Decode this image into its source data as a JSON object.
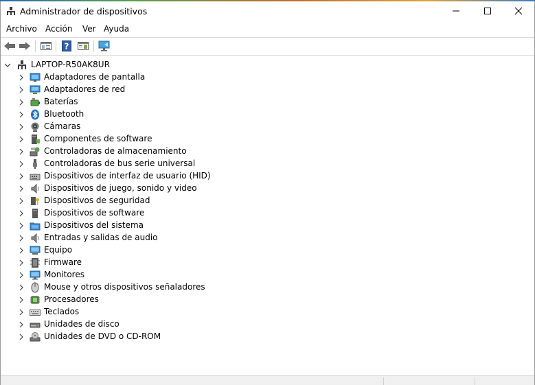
{
  "window": {
    "title": "Administrador de dispositivos",
    "icon": "device-manager-icon",
    "buttons": {
      "minimize": "minimize-icon",
      "maximize": "maximize-icon",
      "close": "close-icon"
    }
  },
  "menu": [
    "Archivo",
    "Acción",
    "Ver",
    "Ayuda"
  ],
  "toolbar": [
    "back-arrow-icon",
    "forward-arrow-icon",
    "properties-panel-icon",
    "help-icon",
    "console-tree-icon",
    "scan-hardware-monitor-icon"
  ],
  "tree": {
    "root": "LAPTOP-R50AK8UR",
    "items": [
      {
        "label": "Adaptadores de pantalla",
        "icon": "display-adapter-icon"
      },
      {
        "label": "Adaptadores de red",
        "icon": "network-adapter-icon"
      },
      {
        "label": "Baterías",
        "icon": "battery-icon"
      },
      {
        "label": "Bluetooth",
        "icon": "bluetooth-icon"
      },
      {
        "label": "Cámaras",
        "icon": "camera-icon"
      },
      {
        "label": "Componentes de software",
        "icon": "software-component-icon"
      },
      {
        "label": "Controladoras de almacenamiento",
        "icon": "storage-controller-icon"
      },
      {
        "label": "Controladoras de bus serie universal",
        "icon": "usb-icon"
      },
      {
        "label": "Dispositivos de interfaz de usuario (HID)",
        "icon": "hid-icon"
      },
      {
        "label": "Dispositivos de juego, sonido y video",
        "icon": "speaker-icon"
      },
      {
        "label": "Dispositivos de seguridad",
        "icon": "security-key-icon"
      },
      {
        "label": "Dispositivos de software",
        "icon": "software-device-icon"
      },
      {
        "label": "Dispositivos del sistema",
        "icon": "system-folder-icon"
      },
      {
        "label": "Entradas y salidas de audio",
        "icon": "audio-io-icon"
      },
      {
        "label": "Equipo",
        "icon": "computer-icon"
      },
      {
        "label": "Firmware",
        "icon": "firmware-icon"
      },
      {
        "label": "Monitores",
        "icon": "monitor-icon"
      },
      {
        "label": "Mouse y otros dispositivos señaladores",
        "icon": "mouse-icon"
      },
      {
        "label": "Procesadores",
        "icon": "processor-icon"
      },
      {
        "label": "Teclados",
        "icon": "keyboard-icon"
      },
      {
        "label": "Unidades de disco",
        "icon": "disk-drive-icon"
      },
      {
        "label": "Unidades de DVD o CD-ROM",
        "icon": "dvd-drive-icon"
      }
    ]
  },
  "colors": {
    "accent": "#1e6fc8",
    "text": "#000000",
    "separator": "#d9d9d9"
  }
}
